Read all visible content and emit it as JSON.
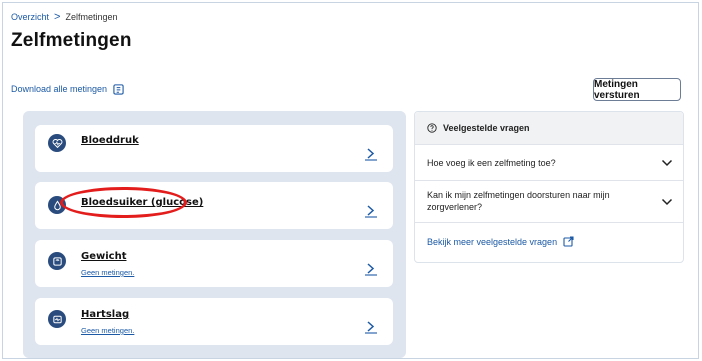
{
  "breadcrumb": {
    "root": "Overzicht",
    "separator": ">",
    "current": "Zelfmetingen"
  },
  "page": {
    "title": "Zelfmetingen",
    "download_label": "Download alle metingen",
    "send_button_label": "Metingen versturen"
  },
  "measurements": [
    {
      "title": "Bloeddruk",
      "subtitle": "",
      "icon": "heart-pulse-icon"
    },
    {
      "title": "Bloedsuiker (glucose)",
      "subtitle": "",
      "icon": "drop-icon"
    },
    {
      "title": "Gewicht",
      "subtitle": "Geen metingen.",
      "icon": "scale-icon"
    },
    {
      "title": "Hartslag",
      "subtitle": "Geen metingen.",
      "icon": "heart-rate-monitor-icon"
    }
  ],
  "faq": {
    "title": "Veelgestelde vragen",
    "items": [
      {
        "question": "Hoe voeg ik een zelfmeting toe?"
      },
      {
        "question": "Kan ik mijn zelfmetingen doorsturen naar mijn zorgverlener?"
      }
    ],
    "more_link": "Bekijk meer veelgestelde vragen"
  },
  "colors": {
    "link": "#1c5aa6",
    "icon_bg": "#2a4b7d",
    "panel_bg": "#dfe5ef",
    "highlight": "#e31c1c"
  }
}
